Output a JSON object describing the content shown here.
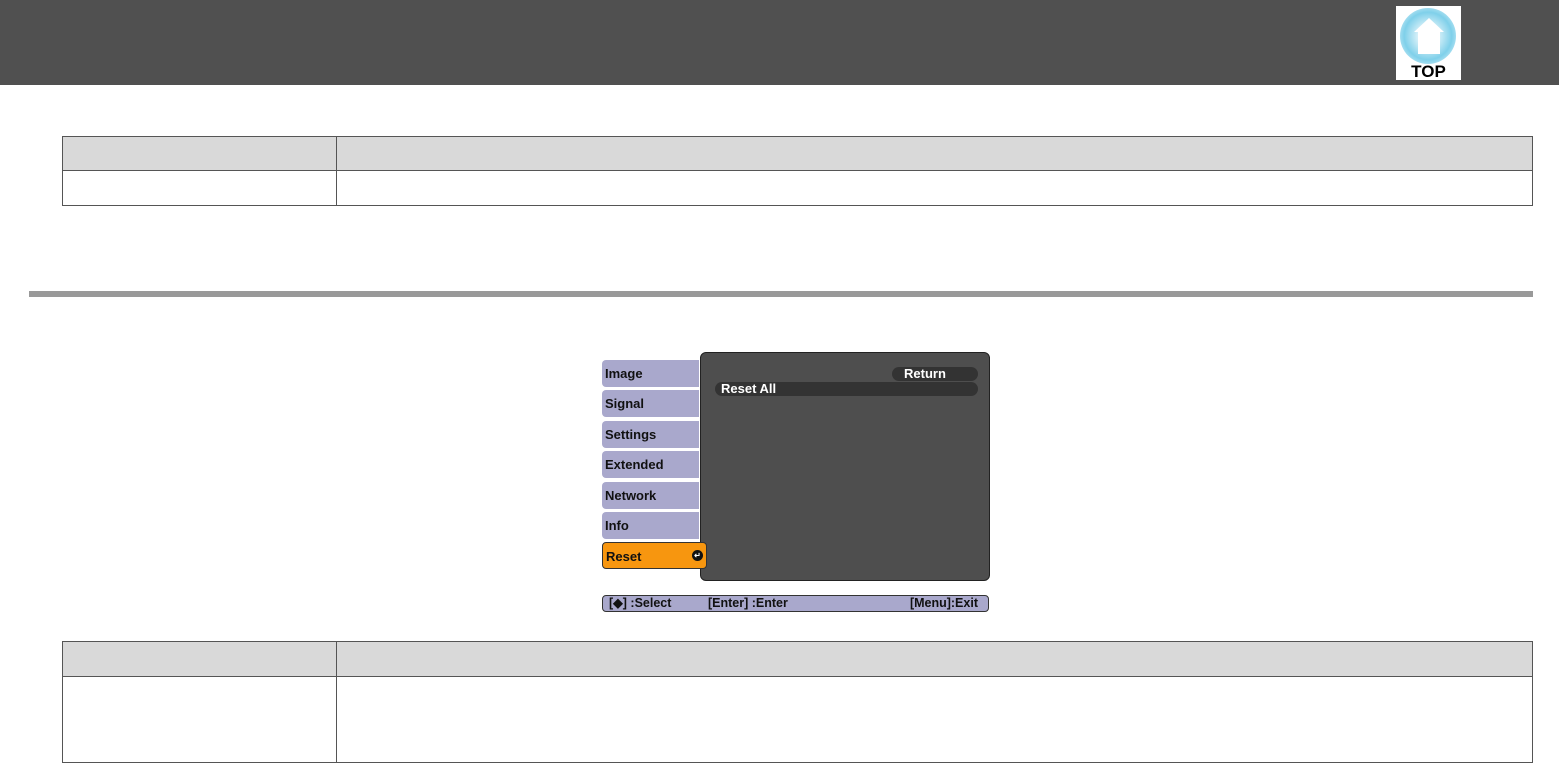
{
  "header": {
    "top_label": "TOP",
    "top_icon": "home-icon"
  },
  "osd": {
    "tabs": [
      "Image",
      "Signal",
      "Settings",
      "Extended",
      "Network",
      "Info",
      "Reset"
    ],
    "selected_tab": "Reset",
    "return_label": "Return",
    "items": [
      "Reset All"
    ],
    "help": {
      "select": "[◆] :Select",
      "enter": "[Enter] :Enter",
      "exit": "[Menu]:Exit"
    }
  }
}
